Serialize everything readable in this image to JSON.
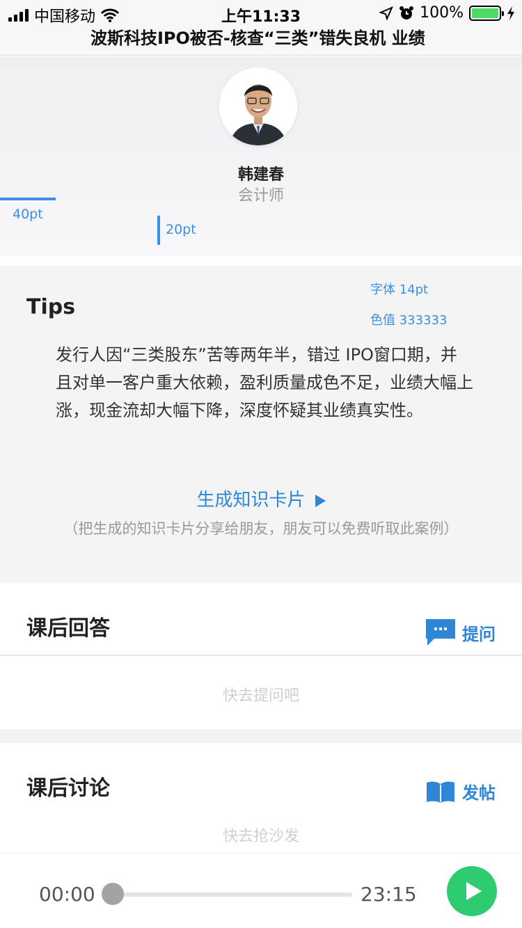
{
  "status_bar": {
    "carrier": "中国移动",
    "time": "上午11:33",
    "battery": "100%"
  },
  "title_bar": {
    "title": "波斯科技IPO被否-核查“三类”错失良机 业绩"
  },
  "profile": {
    "name": "韩建春",
    "role": "会计师",
    "measure_h": "40pt",
    "measure_v": "20pt"
  },
  "tips": {
    "title": "Tips",
    "annotation_font": "字体 14pt",
    "annotation_color": "色值 333333",
    "body": "发行人因“三类股东”苦等两年半，错过 IPO窗口期，并且对单一客户重大依赖，盈利质量成色不足，业绩大幅上涨，现金流却大幅下降，深度怀疑其业绩真实性。",
    "card_link": "生成知识卡片",
    "card_note": "（把生成的知识卡片分享给朋友，朋友可以免费听取此案例）"
  },
  "answers": {
    "title": "课后回答",
    "action": "提问",
    "action_icon": "chat-bubble-icon",
    "placeholder": "快去提问吧"
  },
  "discussion": {
    "title": "课后讨论",
    "action": "发帖",
    "action_icon": "open-book-icon",
    "placeholder": "快去抢沙发"
  },
  "player": {
    "current": "00:00",
    "duration": "23:15",
    "progress": 0
  },
  "colors": {
    "accent_blue": "#2d86d6",
    "annotation_blue": "#3a8ee6",
    "play_green": "#2ecc71",
    "body_text": "#333333"
  }
}
